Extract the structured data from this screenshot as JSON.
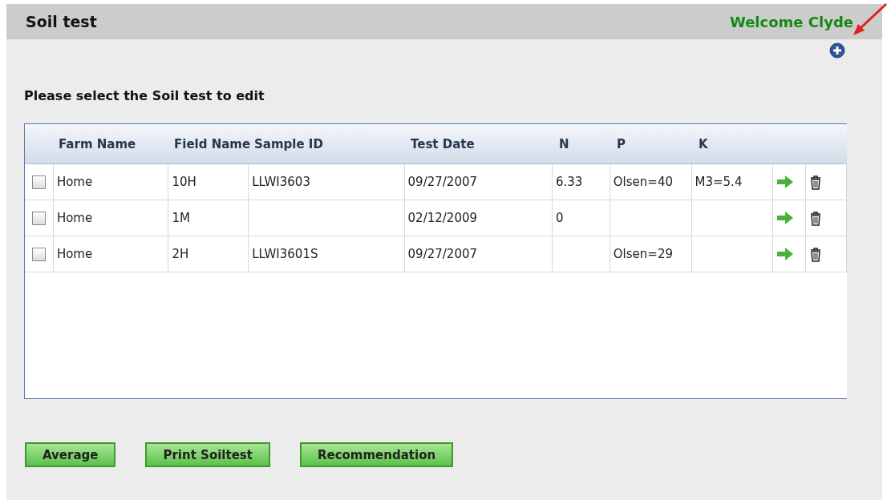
{
  "header": {
    "title": "Soil test",
    "welcome": "Welcome Clyde"
  },
  "prompt": "Please select the Soil test to edit",
  "table": {
    "columns": [
      "Farm Name",
      "Field Name",
      "Sample ID",
      "Test Date",
      "N",
      "P",
      "K"
    ],
    "rows": [
      {
        "checked": false,
        "cells": [
          "Home",
          "10H",
          "LLWI3603",
          "09/27/2007",
          "6.33",
          "Olsen=40",
          "M3=5.4"
        ]
      },
      {
        "checked": false,
        "cells": [
          "Home",
          "1M",
          null,
          "02/12/2009",
          "0",
          null,
          null
        ]
      },
      {
        "checked": false,
        "cells": [
          "Home",
          "2H",
          "LLWI3601S",
          "09/27/2007",
          null,
          "Olsen=29",
          null
        ]
      }
    ]
  },
  "buttons": [
    "Average",
    "Print Soiltest",
    "Recommendation"
  ]
}
